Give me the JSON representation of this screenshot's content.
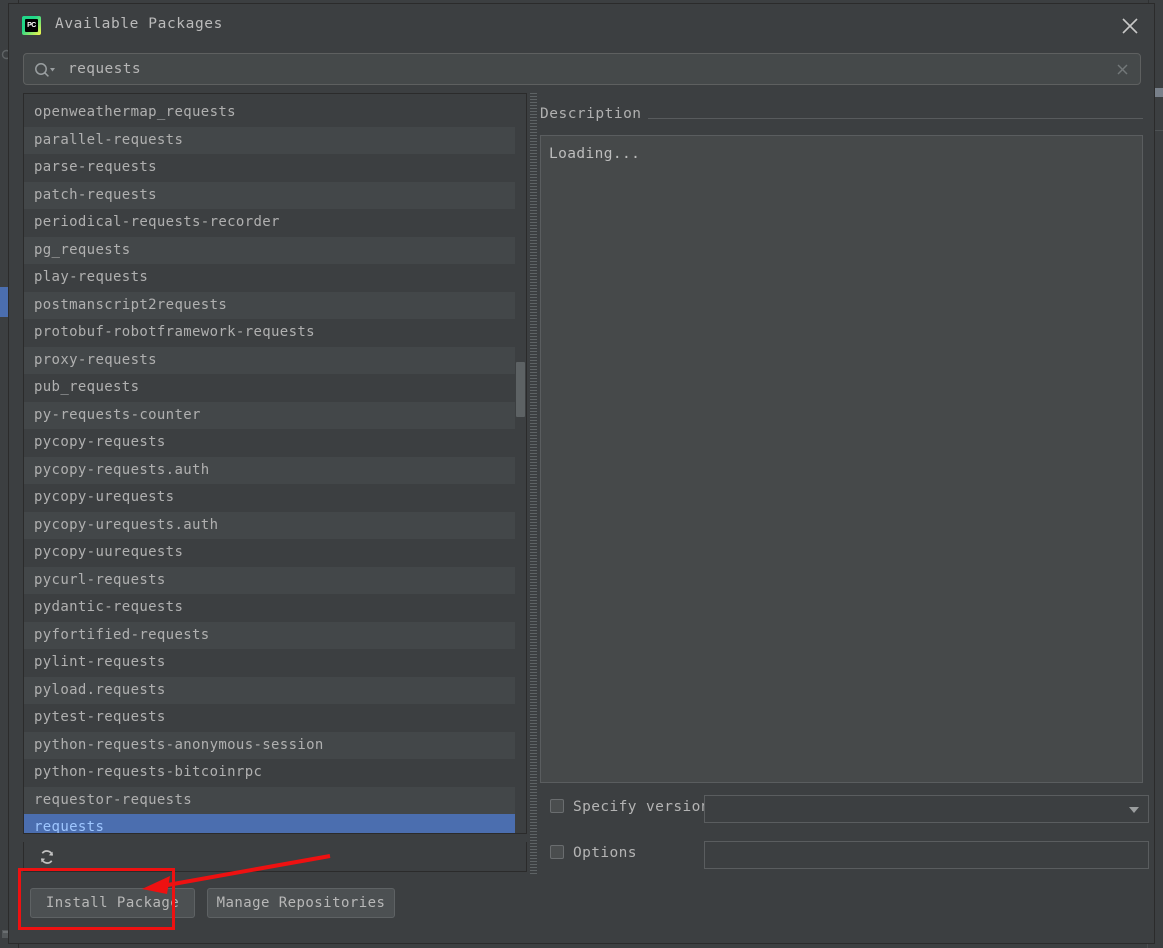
{
  "window": {
    "title": "Available Packages",
    "app_icon": "pycharm-icon",
    "close_label": "close-icon"
  },
  "search": {
    "value": "requests",
    "placeholder": "",
    "icon": "search-icon",
    "clear_icon": "clear-icon"
  },
  "package_list": {
    "items": [
      "openweathermap_requests",
      "parallel-requests",
      "parse-requests",
      "patch-requests",
      "periodical-requests-recorder",
      "pg_requests",
      "play-requests",
      "postmanscript2requests",
      "protobuf-robotframework-requests",
      "proxy-requests",
      "pub_requests",
      "py-requests-counter",
      "pycopy-requests",
      "pycopy-requests.auth",
      "pycopy-urequests",
      "pycopy-urequests.auth",
      "pycopy-uurequests",
      "pycurl-requests",
      "pydantic-requests",
      "pyfortified-requests",
      "pylint-requests",
      "pyload.requests",
      "pytest-requests",
      "python-requests-anonymous-session",
      "python-requests-bitcoinrpc",
      "requestor-requests",
      "requests"
    ],
    "selected_index": 26,
    "selected_value": "requests",
    "refresh_icon": "refresh-icon",
    "scrollbar": "vertical-scrollbar"
  },
  "description": {
    "header": "Description",
    "body": "Loading..."
  },
  "options": {
    "specify_version": {
      "label": "Specify version",
      "checked": false,
      "value": "",
      "control": "combobox"
    },
    "options_flags": {
      "label": "Options",
      "checked": false,
      "value": "",
      "control": "textfield"
    }
  },
  "buttons": {
    "install": "Install Package",
    "manage": "Manage Repositories"
  },
  "annotations": {
    "highlight_target": "Install Package",
    "rect_color": "#ee1111",
    "arrow_color": "#ee1111"
  },
  "colors": {
    "dialog_bg": "#3c3f41",
    "row_even": "#434749",
    "row_odd": "#3c3f41",
    "selection": "#4b6eaf",
    "selection_text": "#9ec6ff",
    "text": "#b0b0b0",
    "field_bg": "#45494a",
    "border": "#2b2b2b"
  }
}
